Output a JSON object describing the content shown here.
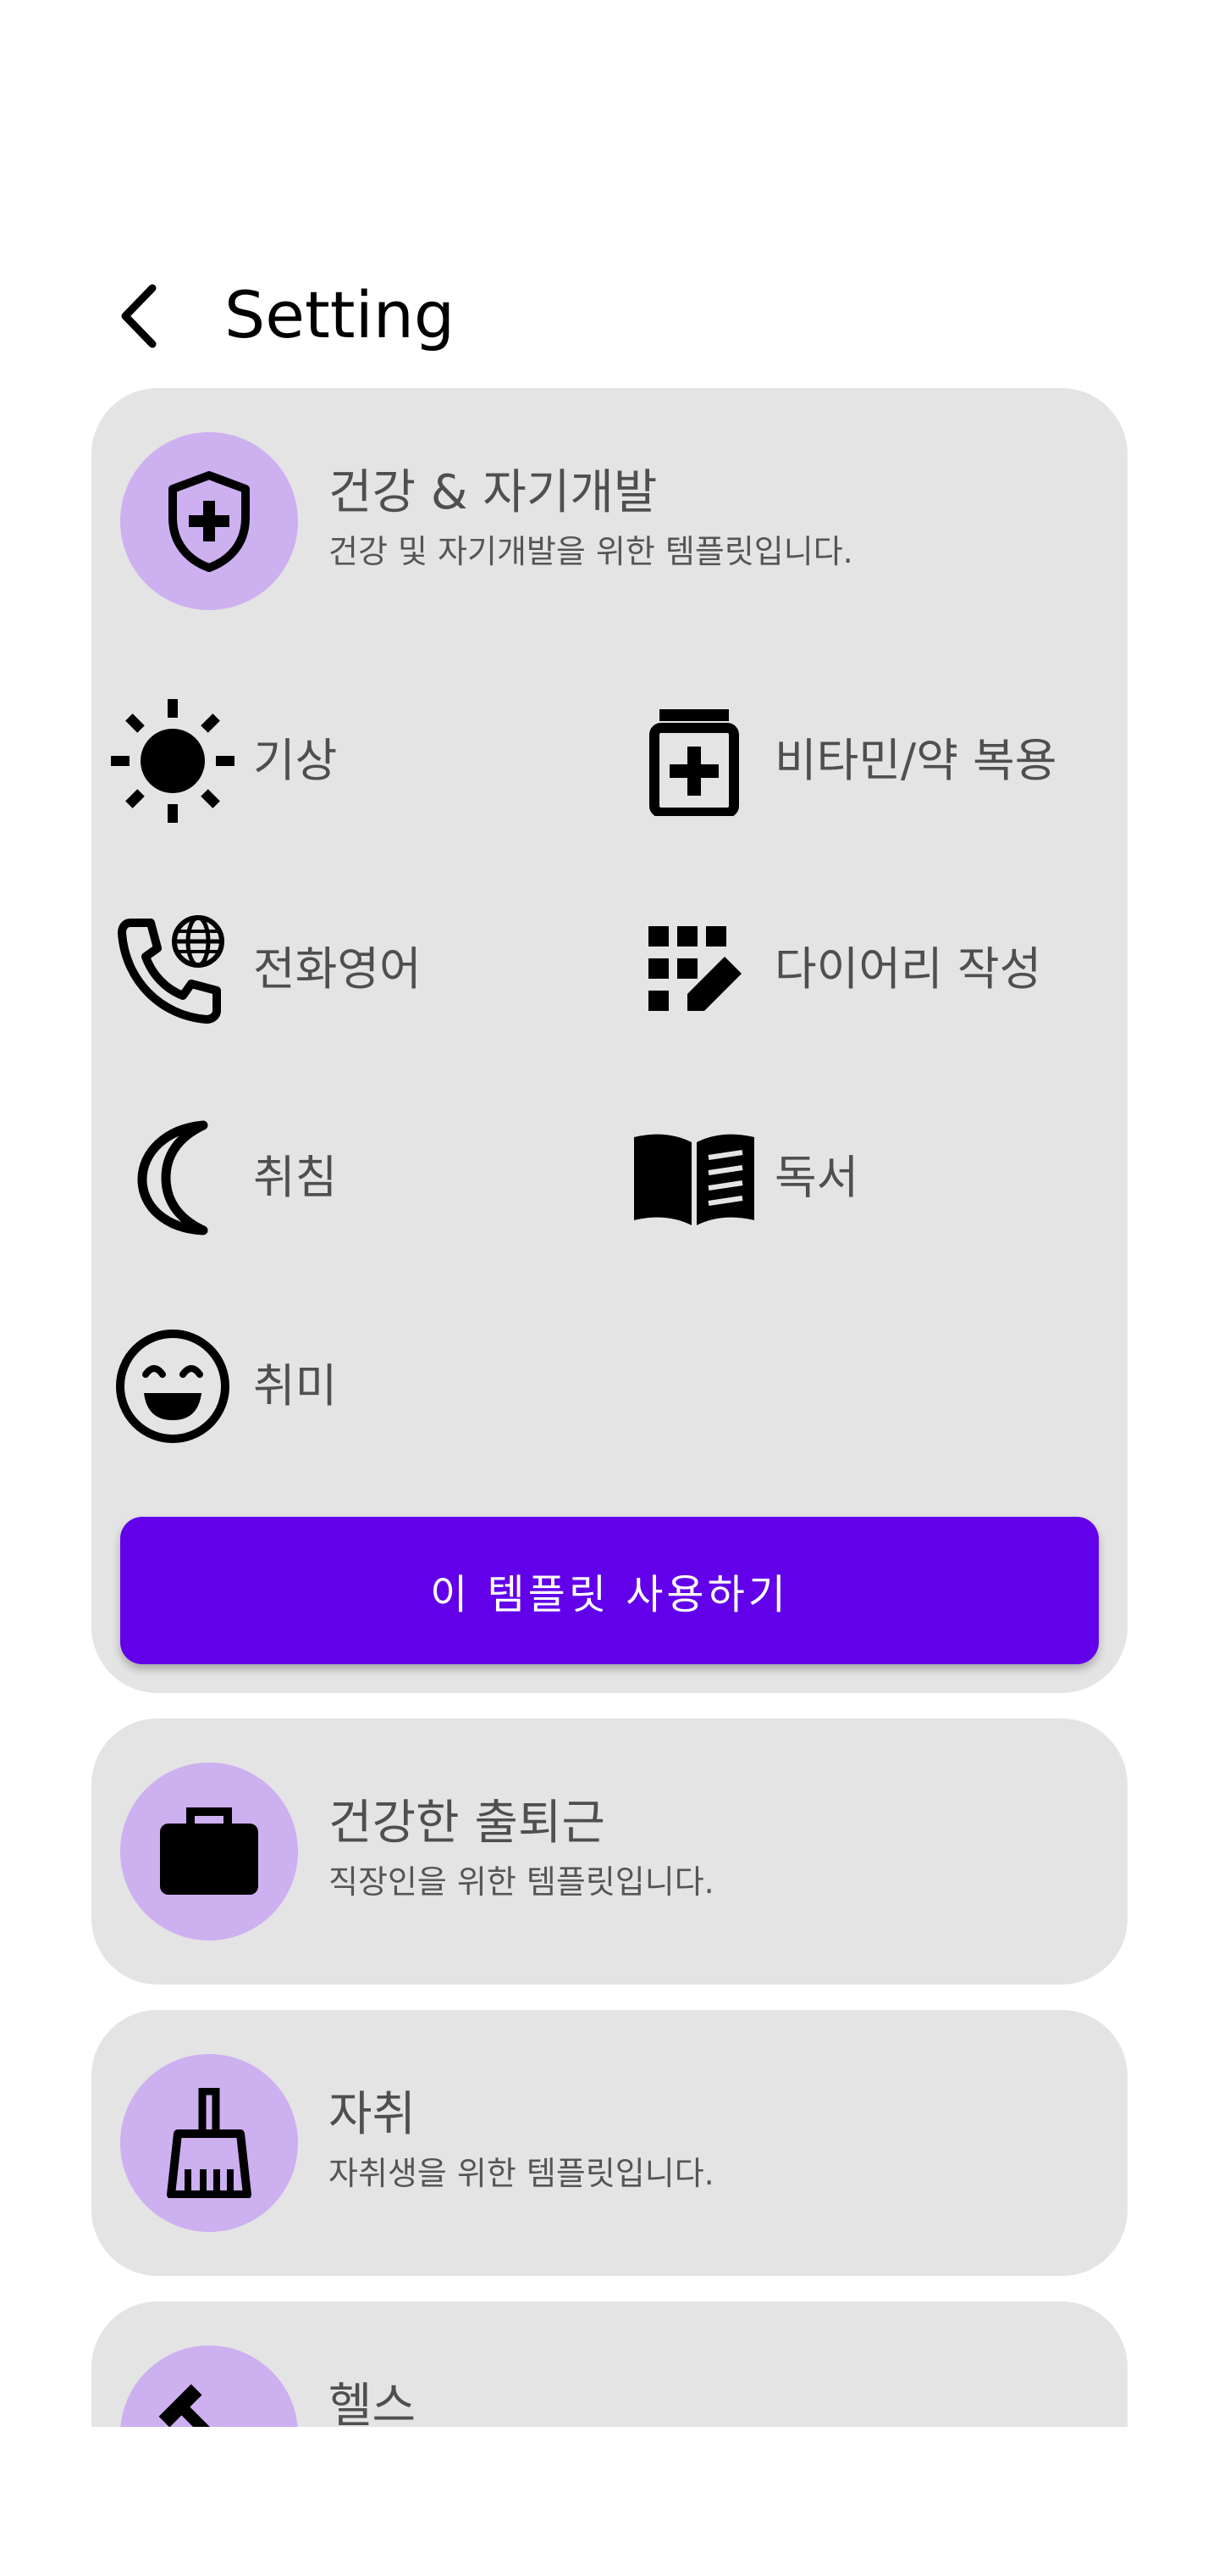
{
  "header": {
    "title": "Setting"
  },
  "templates": [
    {
      "title": "건강 & 자기개발",
      "description": "건강 및 자기개발을 위한 템플릿입니다.",
      "icon": "shield-plus-icon",
      "items": [
        {
          "label": "기상",
          "icon": "sun-icon"
        },
        {
          "label": "비타민/약 복용",
          "icon": "medication-icon"
        },
        {
          "label": "전화영어",
          "icon": "phone-globe-icon"
        },
        {
          "label": "다이어리 작성",
          "icon": "grid-pen-icon"
        },
        {
          "label": "취침",
          "icon": "moon-icon"
        },
        {
          "label": "독서",
          "icon": "open-book-icon"
        },
        {
          "label": "취미",
          "icon": "smile-icon"
        }
      ],
      "button_label": "이 템플릿 사용하기"
    },
    {
      "title": "건강한 출퇴근",
      "description": "직장인을 위한 템플릿입니다.",
      "icon": "briefcase-icon"
    },
    {
      "title": "자취",
      "description": "자취생을 위한 템플릿입니다.",
      "icon": "broom-icon"
    },
    {
      "title": "헬스",
      "description": "",
      "icon": "dumbbell-icon"
    }
  ],
  "colors": {
    "accent": "#6200ea",
    "avatar": "#cdb0f0",
    "card": "#e4e4e4"
  }
}
